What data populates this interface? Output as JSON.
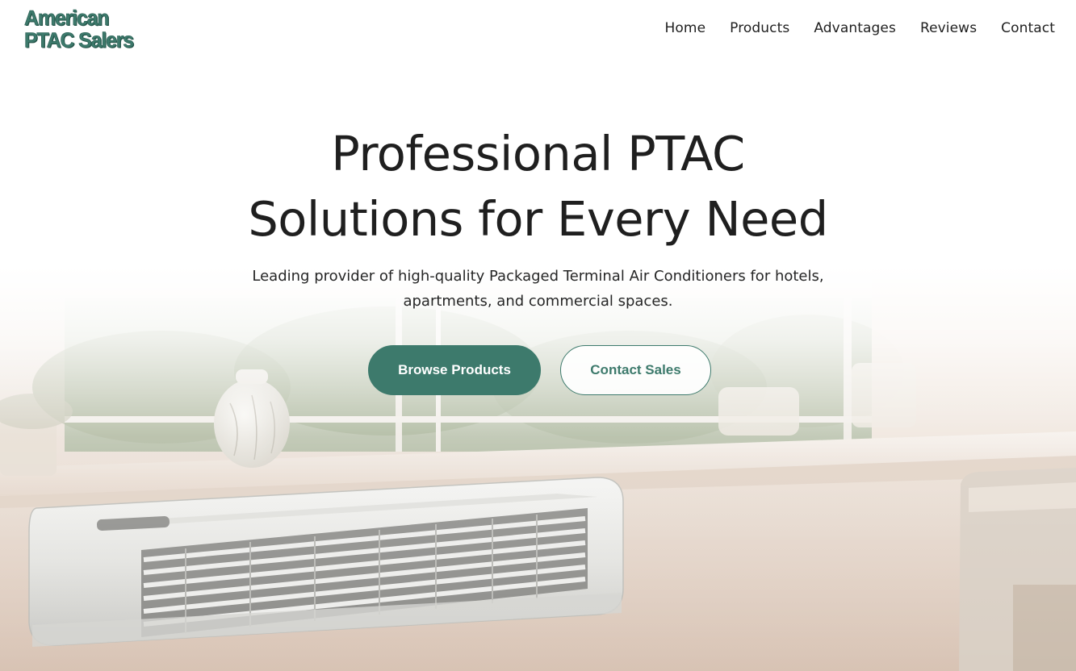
{
  "header": {
    "logo_line1": "American",
    "logo_line2": "PTAC Salers",
    "nav": [
      {
        "label": "Home"
      },
      {
        "label": "Products"
      },
      {
        "label": "Advantages"
      },
      {
        "label": "Reviews"
      },
      {
        "label": "Contact"
      }
    ]
  },
  "hero": {
    "title_line1": "Professional PTAC",
    "title_line2": "Solutions for Every Need",
    "subtitle_line1": "Leading provider of high-quality Packaged Terminal Air Conditioners for hotels,",
    "subtitle_line2": "apartments, and commercial spaces.",
    "primary_button": "Browse Products",
    "secondary_button": "Contact Sales"
  },
  "colors": {
    "brand": "#3d7a6c",
    "text": "#1f1f1f",
    "background": "#ffffff"
  }
}
